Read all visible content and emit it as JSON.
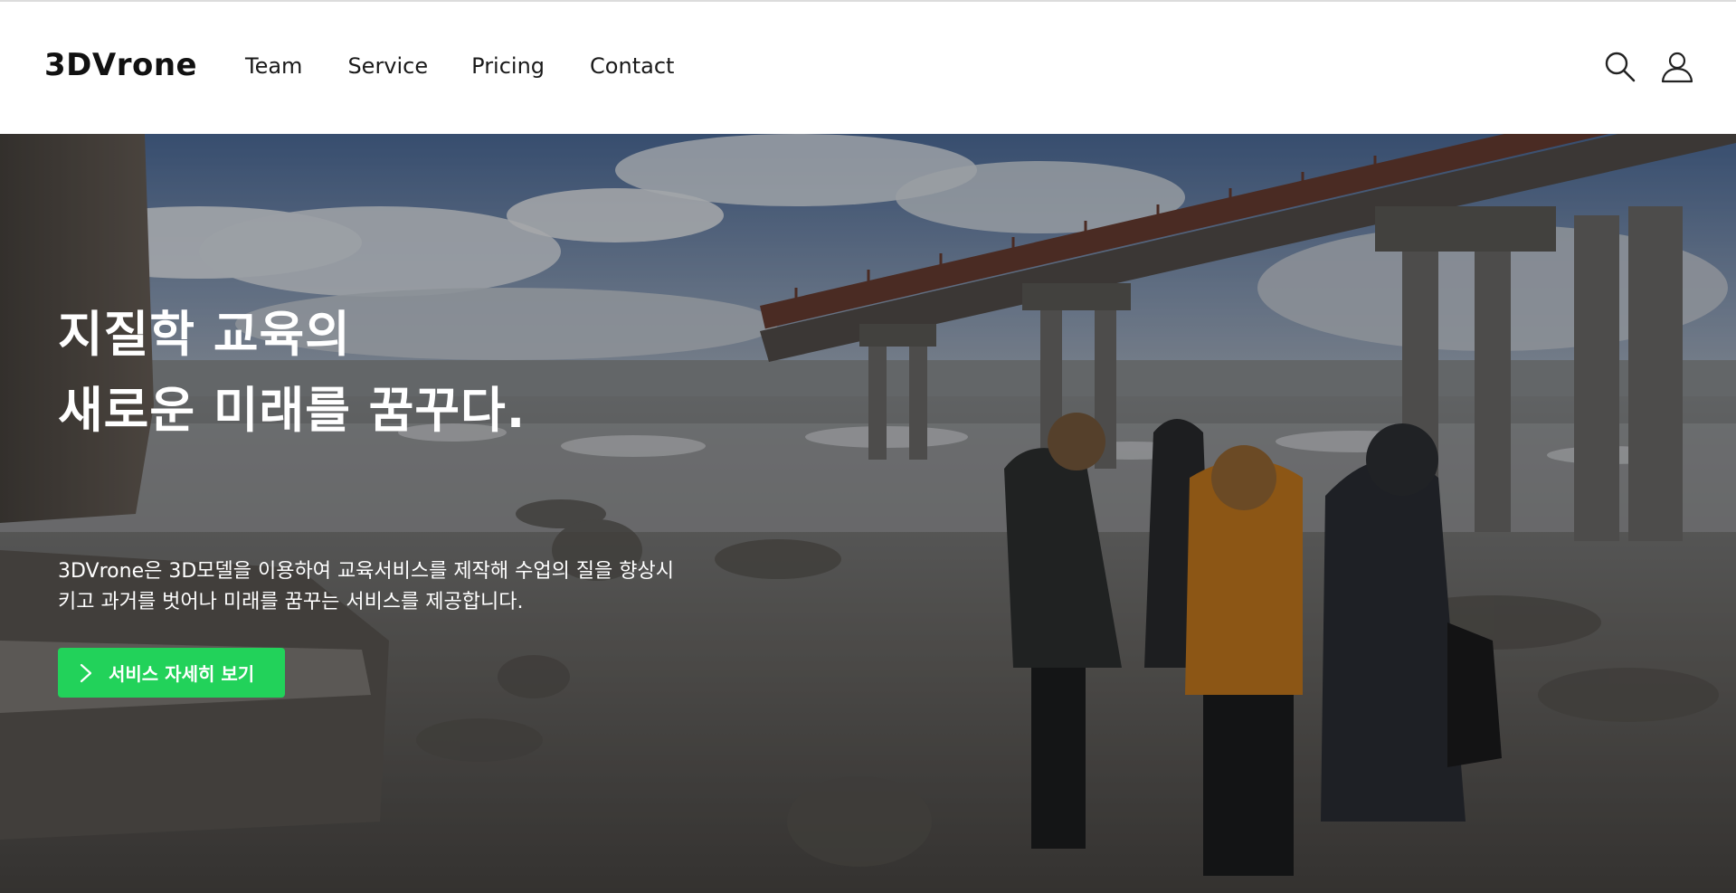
{
  "header": {
    "brand": "3DVrone",
    "nav": [
      {
        "label": "Team"
      },
      {
        "label": "Service"
      },
      {
        "label": "Pricing"
      },
      {
        "label": "Contact"
      }
    ],
    "icons": {
      "search": "search-icon",
      "user": "user-icon"
    }
  },
  "hero": {
    "title_line1": "지질학 교육의",
    "title_line2": "새로운 미래를 꿈꾸다.",
    "description_line1": "3DVrone은 3D모델을 이용하여 교육서비스를 제작해 수업의 질을 향상시",
    "description_line2": "키고 과거를 벗어나 미래를 꿈꾸는 서비스를 제공합니다.",
    "cta_label": "서비스 자세히 보기",
    "cta_color": "#22d25a"
  }
}
